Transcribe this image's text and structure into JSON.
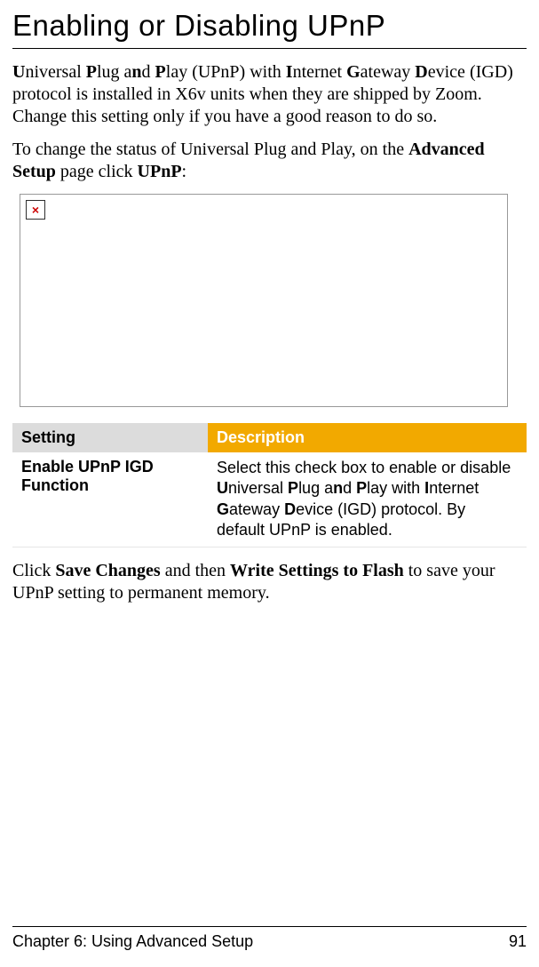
{
  "title": "Enabling or Disabling UPnP",
  "para1_html": "<b>U</b>niversal <b>P</b>lug a<b>n</b>d <b>P</b>lay (UPnP) with <b>I</b>nternet <b>G</b>ateway <b>D</b>evice (IGD) protocol is installed in X6v units when they are shipped by Zoom. Change this setting only if you have a good reason to do so.",
  "para2_html": "To change the status of Universal Plug and Play, on the <b>Advanced Setup</b> page click <b>UPnP</b>:",
  "broken_img_glyph": "×",
  "table": {
    "headers": {
      "setting": "Setting",
      "description": "Description"
    },
    "rows": [
      {
        "setting": "Enable UPnP IGD Function",
        "description_html": "Select this check box to enable or disable <b>U</b>niversal <b>P</b>lug a<b>n</b>d <b>P</b>lay with <b>I</b>nternet <b>G</b>ateway <b>D</b>evice (IGD) protocol. By default UPnP is enabled."
      }
    ]
  },
  "para3_html": "Click <b>Save Changes</b> and then <b>Write Settings to Flash</b> to save your UPnP setting to permanent memory.",
  "footer": {
    "chapter": "Chapter 6: Using Advanced Setup",
    "page": "91"
  }
}
